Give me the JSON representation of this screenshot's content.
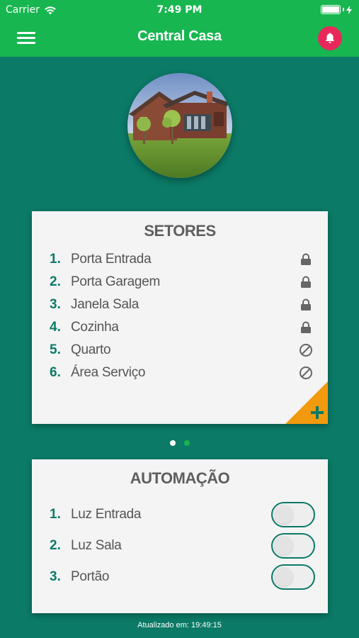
{
  "status_bar": {
    "carrier": "Carrier",
    "time": "7:49 PM"
  },
  "header": {
    "title": "Central Casa"
  },
  "setores": {
    "title": "SETORES",
    "items": [
      {
        "num": "1.",
        "label": "Porta Entrada",
        "status": "locked"
      },
      {
        "num": "2.",
        "label": "Porta Garagem",
        "status": "locked"
      },
      {
        "num": "3.",
        "label": "Janela Sala",
        "status": "locked"
      },
      {
        "num": "4.",
        "label": "Cozinha",
        "status": "locked"
      },
      {
        "num": "5.",
        "label": "Quarto",
        "status": "disabled"
      },
      {
        "num": "6.",
        "label": "Área Serviço",
        "status": "disabled"
      }
    ],
    "add_icon": "plus-icon"
  },
  "pagination": {
    "pages": 2,
    "active": 1
  },
  "automacao": {
    "title": "AUTOMAÇÃO",
    "items": [
      {
        "num": "1.",
        "label": "Luz Entrada",
        "on": false
      },
      {
        "num": "2.",
        "label": "Luz Sala",
        "on": false
      },
      {
        "num": "3.",
        "label": "Portão",
        "on": false
      }
    ]
  },
  "footer": {
    "updated": "Atualizado em: 19:49:15"
  },
  "colors": {
    "primary": "#17b650",
    "background": "#0b7a66",
    "alert": "#e8285a",
    "accent": "#f29a0e"
  }
}
